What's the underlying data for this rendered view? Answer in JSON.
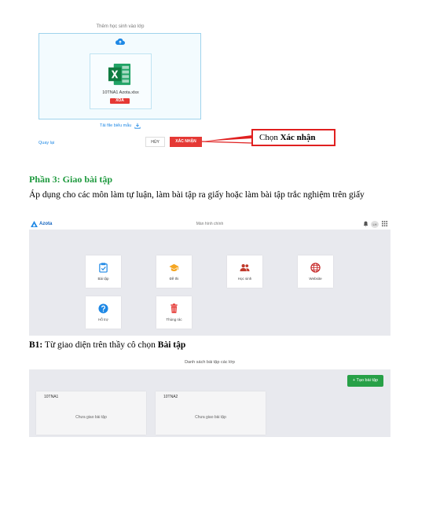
{
  "upload_dialog": {
    "title": "Thêm học sinh vào lớp",
    "file_name": "10TNA1 Azota.xlsx",
    "delete_label": "XÓA",
    "template_link": "Tải file biểu mẫu",
    "back_label": "Quay lại",
    "cancel_label": "HỦY",
    "confirm_label": "XÁC NHẬN",
    "callout_prefix": "Chọn ",
    "callout_bold": "Xác nhận",
    "colors": {
      "danger": "#e53935",
      "link": "#1e88e5",
      "callout_border": "#e02020"
    }
  },
  "text": {
    "part3_heading": "Phần 3: Giao bài tập",
    "part3_desc": "Áp dụng cho các môn làm tự luận, làm bài tập ra giấy hoặc làm bài tập trắc nghiệm trên giấy",
    "b1_prefix": "B1:",
    "b1_text": " Từ giao diện trên thầy cô chọn ",
    "b1_bold": "Bài tập"
  },
  "home": {
    "logo": "Azota",
    "title": "Màn hình chính",
    "avatar_text": "LH",
    "tiles": [
      {
        "label": "Bài tập",
        "icon": "assignment-icon"
      },
      {
        "label": "Đề thi",
        "icon": "graduation-cap-icon"
      },
      {
        "label": "Học sinh",
        "icon": "students-icon"
      },
      {
        "label": "Website",
        "icon": "globe-icon"
      },
      {
        "label": "Hỗ trợ",
        "icon": "help-icon"
      },
      {
        "label": "Thùng rác",
        "icon": "trash-icon"
      }
    ]
  },
  "assignments": {
    "title": "Danh sách bài tập các lớp",
    "new_button": "+ Tạo bài tập",
    "classes": [
      {
        "name": "10TNA1",
        "status": "Chưa giao bài tập"
      },
      {
        "name": "10TNA2",
        "status": "Chưa giao bài tập"
      }
    ],
    "accent": "#27a047"
  }
}
